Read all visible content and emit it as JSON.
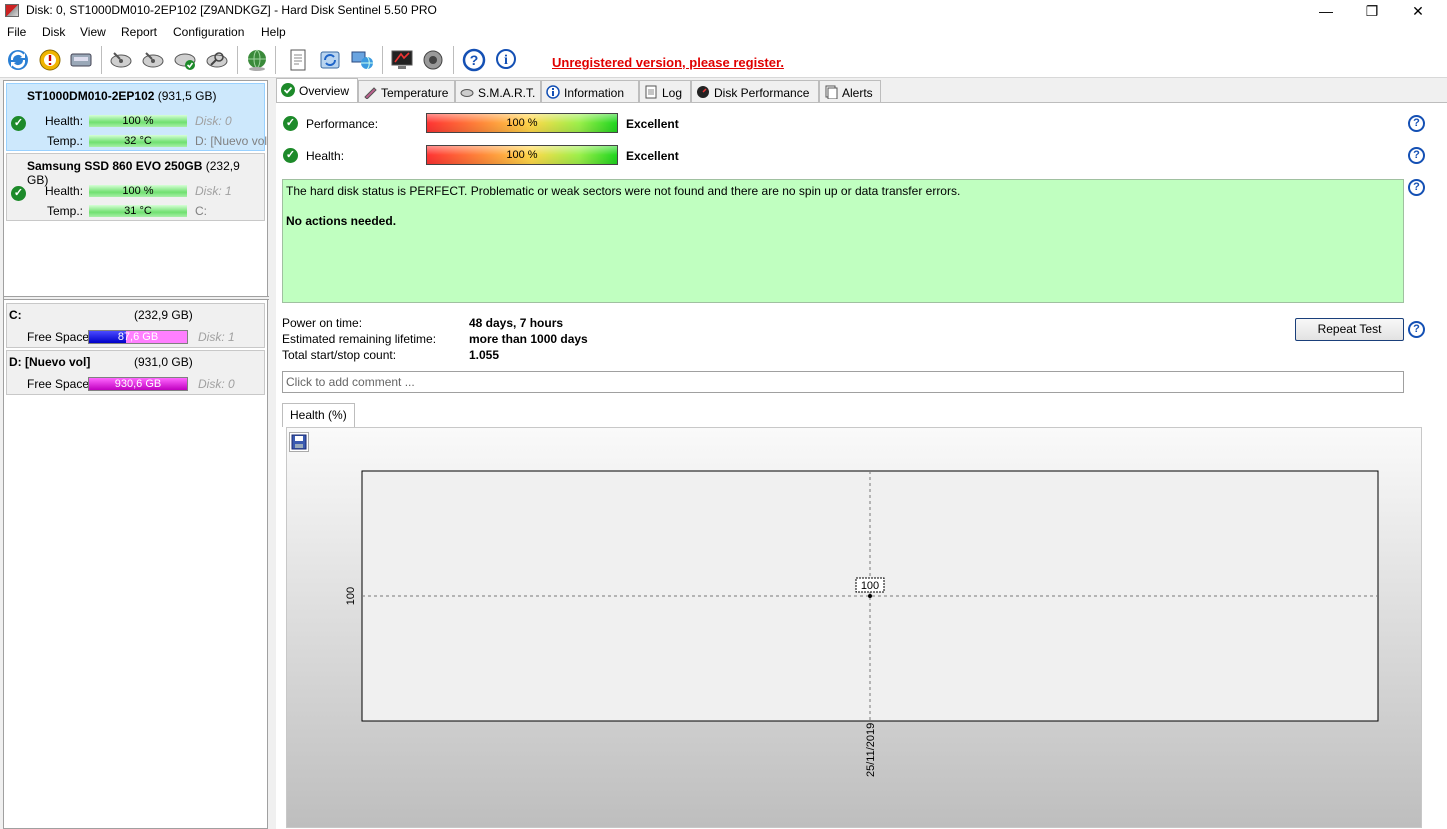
{
  "window": {
    "title": "Disk: 0, ST1000DM010-2EP102 [Z9ANDKGZ]  -  Hard Disk Sentinel 5.50 PRO",
    "minimize": "—",
    "maximize": "❐",
    "close": "✕"
  },
  "menu": [
    "File",
    "Disk",
    "View",
    "Report",
    "Configuration",
    "Help"
  ],
  "toolbar": {
    "register_text": "Unregistered version, please register."
  },
  "disks": [
    {
      "name": "ST1000DM010-2EP102",
      "size": "(931,5 GB)",
      "health_label": "Health:",
      "health": "100 %",
      "disk_no": "Disk: 0",
      "temp_label": "Temp.:",
      "temp": "32 °C",
      "volume": "D: [Nuevo vol"
    },
    {
      "name": "Samsung SSD 860 EVO 250GB",
      "size": "(232,9 GB)",
      "health_label": "Health:",
      "health": "100 %",
      "disk_no": "Disk: 1",
      "temp_label": "Temp.:",
      "temp": "31 °C",
      "volume": "C:"
    }
  ],
  "volumes": [
    {
      "name": "C:",
      "size": "(232,9 GB)",
      "free_label": "Free Space",
      "free": "87,6 GB",
      "free_fraction": 0.376,
      "disk_no": "Disk: 1"
    },
    {
      "name": "D: [Nuevo vol]",
      "size": "(931,0 GB)",
      "free_label": "Free Space",
      "free": "930,6 GB",
      "free_fraction": 1.0,
      "disk_no": "Disk: 0"
    }
  ],
  "tabs": [
    "Overview",
    "Temperature",
    "S.M.A.R.T.",
    "Information",
    "Log",
    "Disk Performance",
    "Alerts"
  ],
  "overview": {
    "performance_label": "Performance:",
    "performance_value": "100 %",
    "performance_rating": "Excellent",
    "health_label": "Health:",
    "health_value": "100 %",
    "health_rating": "Excellent",
    "status_text": "The hard disk status is PERFECT. Problematic or weak sectors were not found and there are no spin up or data transfer errors.",
    "status_action": "No actions needed.",
    "power_on_label": "Power on time:",
    "power_on_value": "48 days, 7 hours",
    "lifetime_label": "Estimated remaining lifetime:",
    "lifetime_value": "more than 1000 days",
    "startstop_label": "Total start/stop count:",
    "startstop_value": "1.055",
    "repeat_test": "Repeat Test",
    "comment_placeholder": "Click to add comment ...",
    "chart_tab": "Health (%)"
  },
  "chart_data": {
    "type": "line",
    "x": [
      "25/11/2019"
    ],
    "series": [
      {
        "values": [
          100
        ]
      }
    ],
    "y_tick_labels": [
      "100"
    ],
    "data_labels": [
      "100"
    ],
    "grid": true
  }
}
